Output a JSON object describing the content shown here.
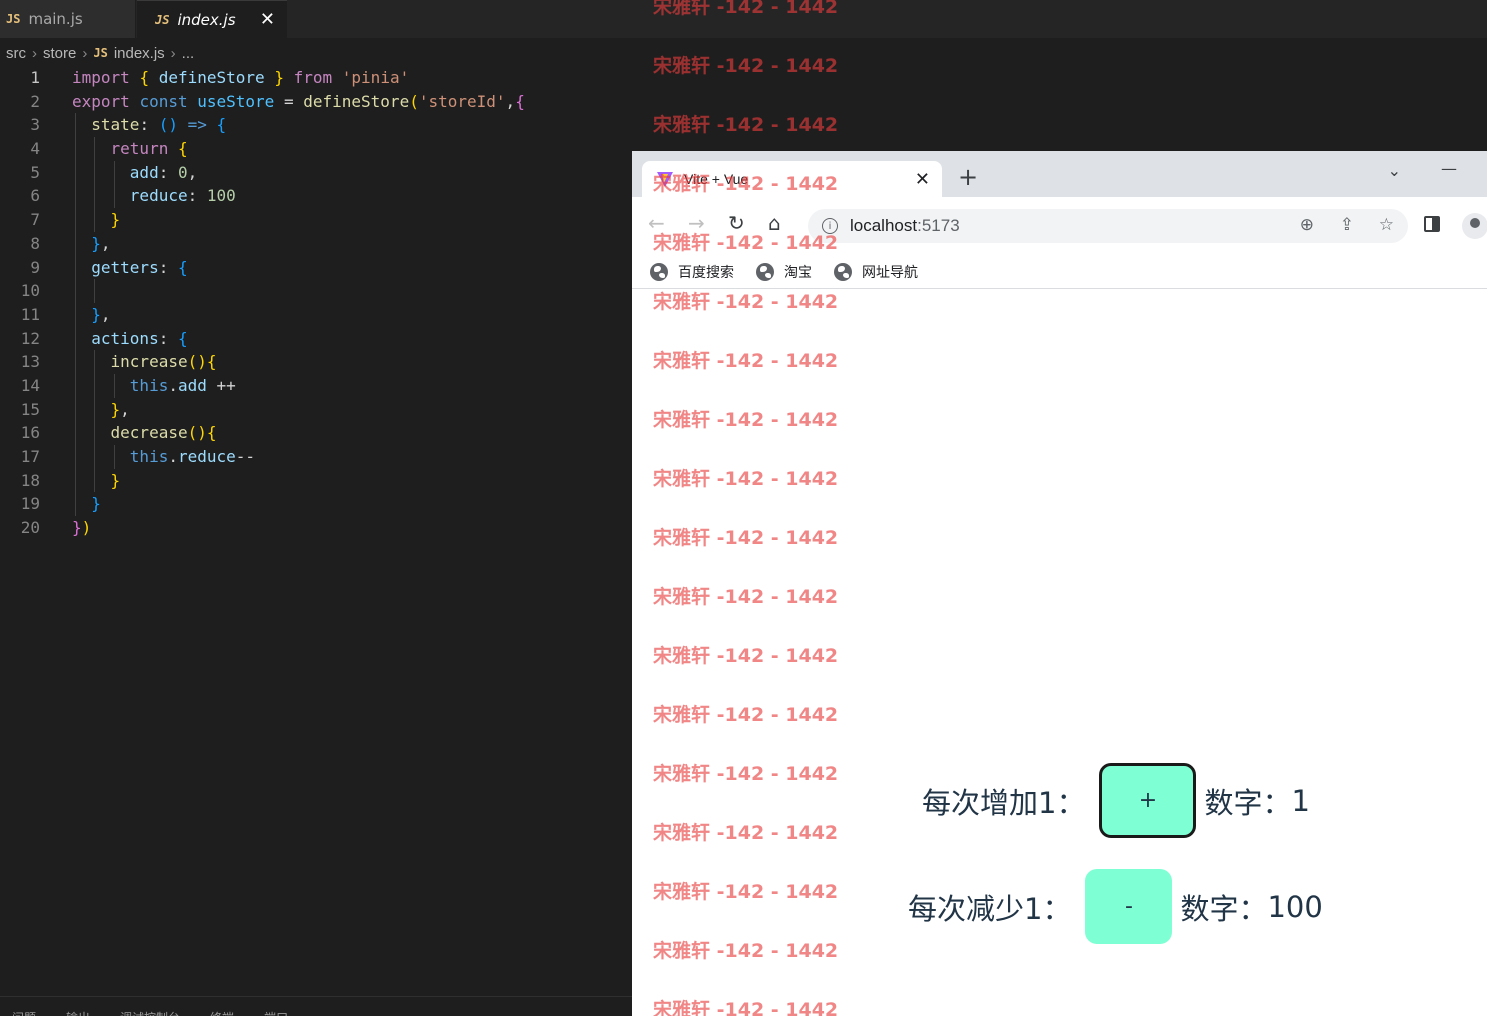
{
  "editor": {
    "tabs": [
      {
        "label": "main.js",
        "icon": "JS"
      },
      {
        "label": "index.js",
        "icon": "JS"
      }
    ],
    "breadcrumb": [
      "src",
      "store",
      "index.js",
      "..."
    ],
    "line_numbers": [
      "1",
      "2",
      "3",
      "4",
      "5",
      "6",
      "7",
      "8",
      "9",
      "10",
      "11",
      "12",
      "13",
      "14",
      "15",
      "16",
      "17",
      "18",
      "19",
      "20"
    ],
    "code": {
      "l1": {
        "import": "import",
        "b_open": "{",
        "name": "defineStore",
        "b_close": "}",
        "from": "from",
        "str": "'pinia'"
      },
      "l2": {
        "export": "export",
        "const": "const",
        "name": "useStore",
        "eq": "=",
        "fn": "defineStore",
        "p_open": "(",
        "str": "'storeId'",
        "comma": ",",
        "b_open": "{"
      },
      "l3": {
        "prop": "state",
        "colon": ":",
        "arrow_parens": "()",
        "arrow": "=>",
        "b_open": "{"
      },
      "l4": {
        "kw": "return",
        "b_open": "{"
      },
      "l5": {
        "prop": "add",
        "colon": ":",
        "num": "0",
        "comma": ","
      },
      "l6": {
        "prop": "reduce",
        "colon": ":",
        "num": "100"
      },
      "l7": {
        "b_close": "}"
      },
      "l8": {
        "b_close": "}",
        "comma": ","
      },
      "l9": {
        "prop": "getters",
        "colon": ":",
        "b_open": "{"
      },
      "l11": {
        "b_close": "}",
        "comma": ","
      },
      "l12": {
        "prop": "actions",
        "colon": ":",
        "b_open": "{"
      },
      "l13": {
        "fn": "increase",
        "parens": "()",
        "b_open": "{"
      },
      "l14": {
        "this": "this",
        "dot": ".",
        "prop": "add",
        "op": " ++"
      },
      "l15": {
        "b_close": "}",
        "comma": ","
      },
      "l16": {
        "fn": "decrease",
        "parens": "()",
        "b_open": "{"
      },
      "l17": {
        "this": "this",
        "dot": ".",
        "prop": "reduce",
        "op": "--"
      },
      "l18": {
        "b_close": "}"
      },
      "l19": {
        "b_close": "}"
      },
      "l20": {
        "b_close": "}",
        "p_close": ")"
      }
    },
    "panel_tabs": [
      "问题",
      "输出",
      "调试控制台",
      "终端",
      "端口"
    ]
  },
  "browser": {
    "tab_title": "Vite + Vue",
    "url_host": "localhost",
    "url_port": ":5173",
    "bookmarks": [
      "百度搜索",
      "淘宝",
      "网址导航"
    ],
    "page": {
      "add_label": "每次增加1：",
      "add_button": "+",
      "add_value_label": "数字：",
      "add_value": "1",
      "sub_label": "每次减少1：",
      "sub_button": "-",
      "sub_value_label": "数字：",
      "sub_value": "100"
    }
  },
  "watermark": "宋雅轩 -142 - 1442"
}
